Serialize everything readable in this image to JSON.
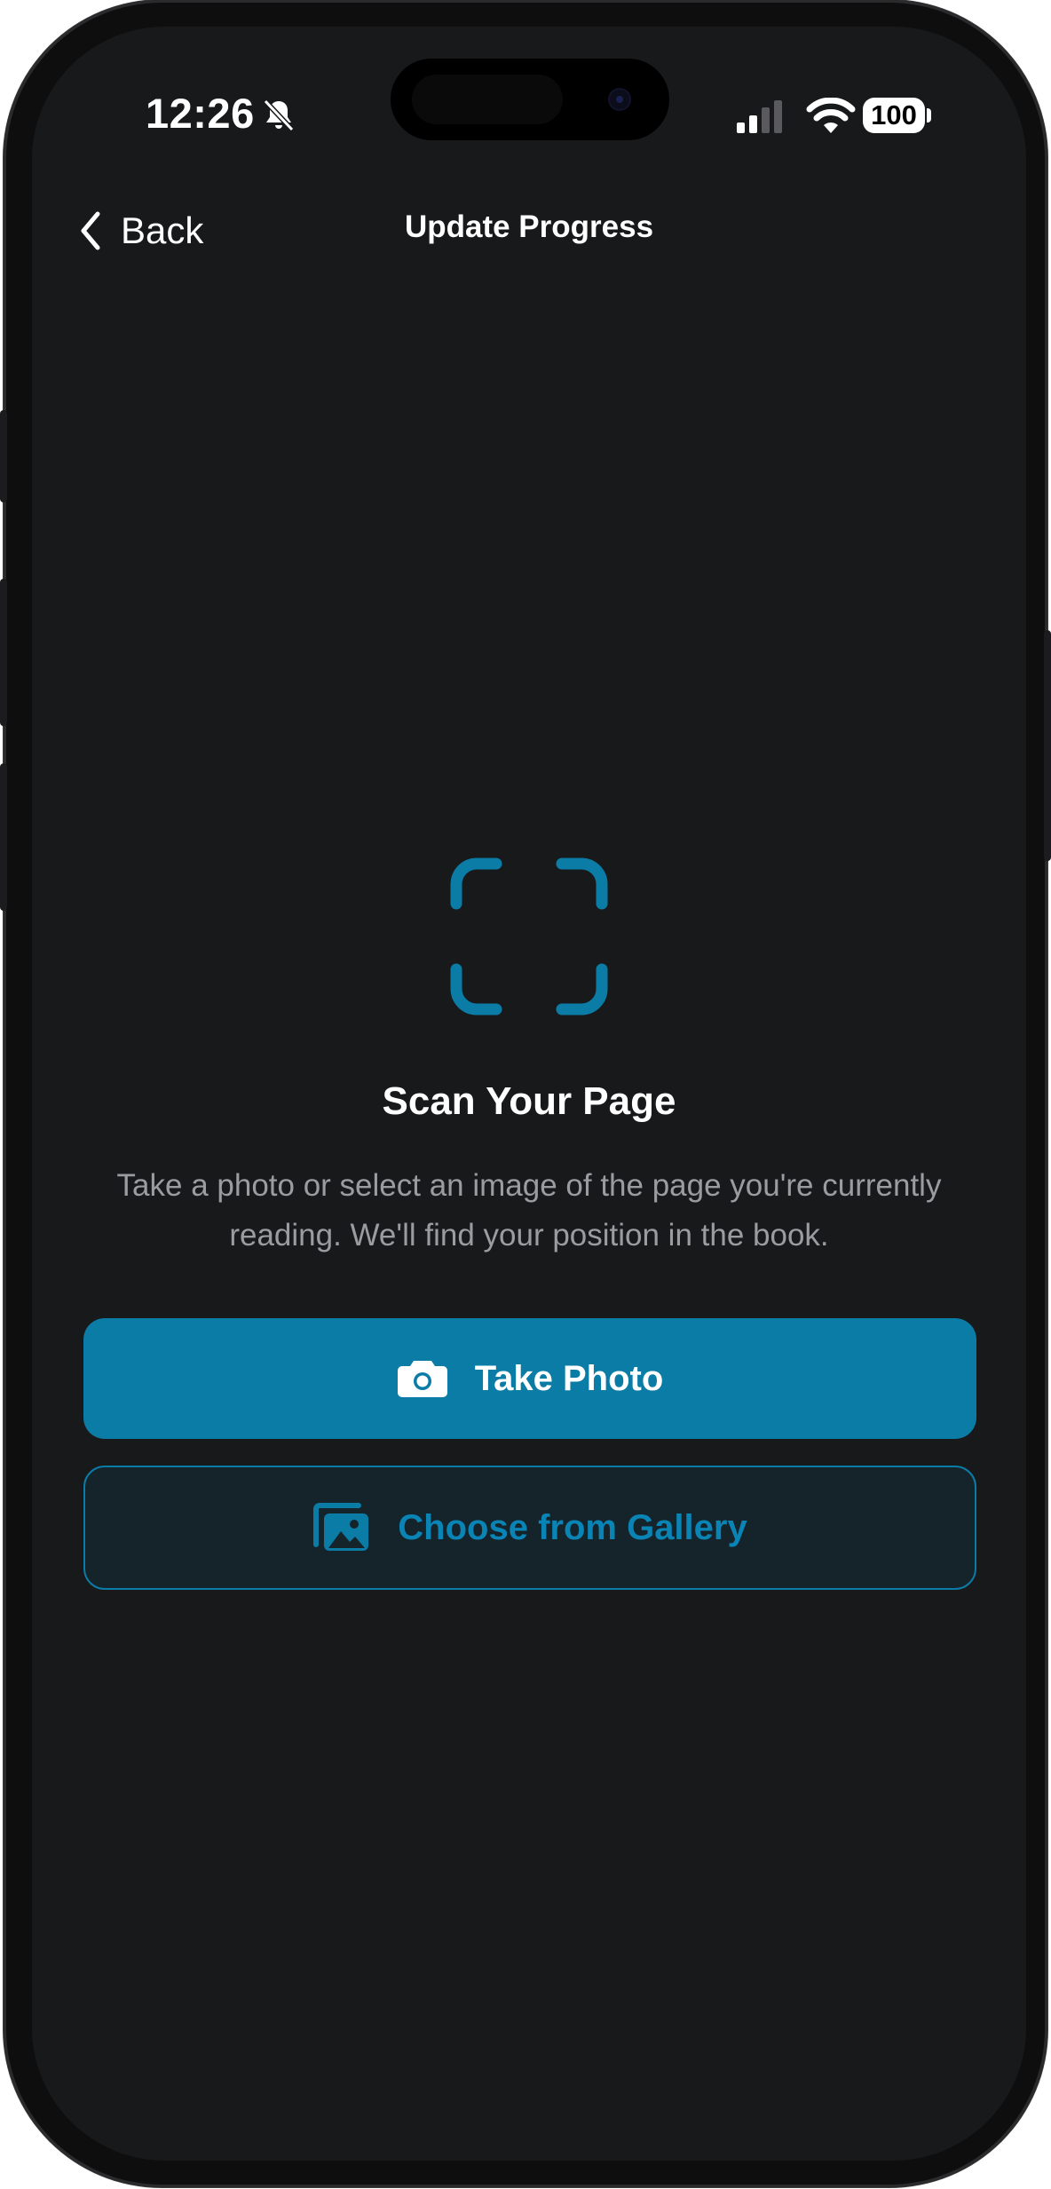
{
  "status_bar": {
    "time": "12:26",
    "battery": "100",
    "icons": [
      "bell-slash-icon",
      "cellular-signal-icon",
      "wifi-icon",
      "battery-icon"
    ]
  },
  "nav": {
    "back_label": "Back",
    "title": "Update Progress"
  },
  "main": {
    "icon": "scan-viewfinder-icon",
    "heading": "Scan Your Page",
    "description": "Take a photo or select an image of the page you're currently reading. We'll find your position in the book."
  },
  "actions": {
    "take_photo_label": "Take Photo",
    "take_photo_icon": "camera-icon",
    "gallery_label": "Choose from Gallery",
    "gallery_icon": "photo-gallery-icon"
  },
  "colors": {
    "accent": "#0a7ca6",
    "background": "#18191b",
    "secondary_text": "#9c9ca0"
  }
}
